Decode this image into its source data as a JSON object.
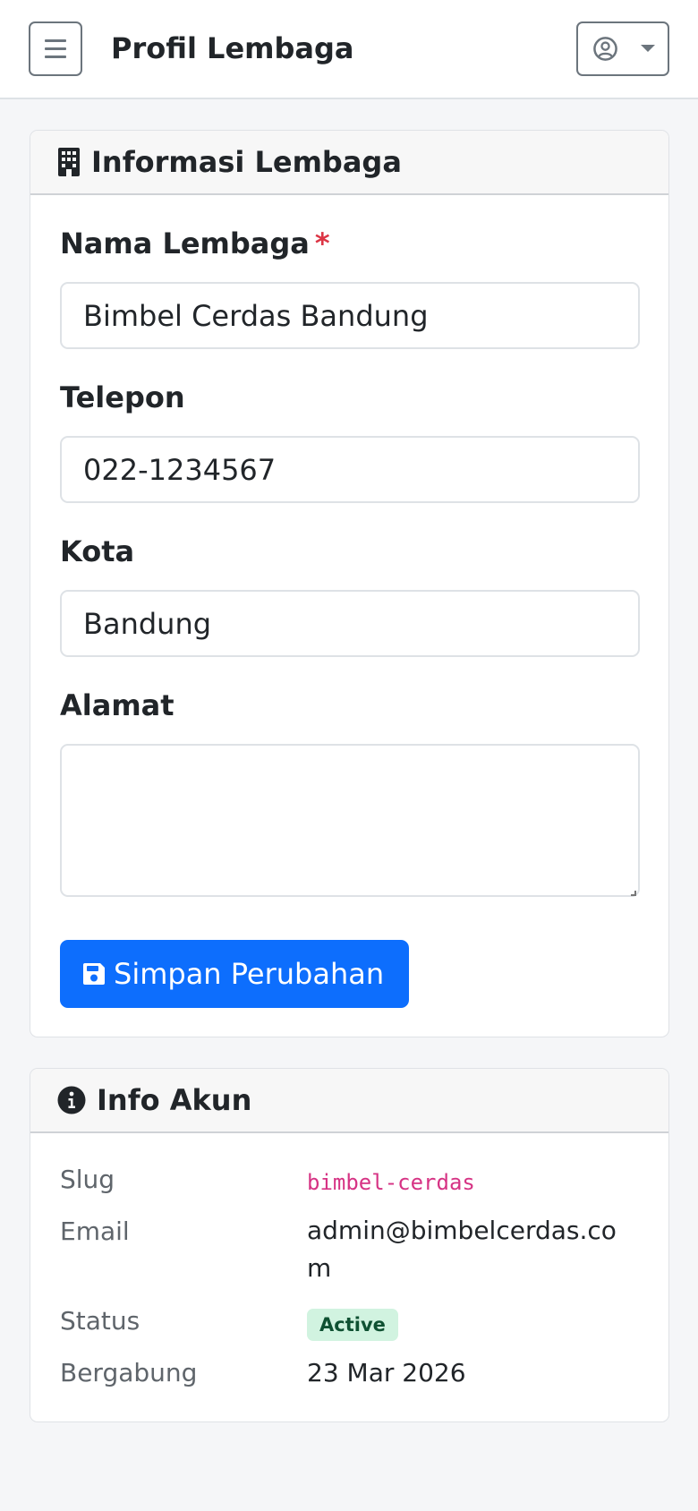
{
  "header": {
    "title": "Profil Lembaga"
  },
  "icons": {
    "menu": "hamburger-icon",
    "user": "user-circle-icon",
    "building": "building-icon",
    "info": "info-circle-icon",
    "save": "floppy-disk-icon"
  },
  "colors": {
    "primary": "#0d6efd",
    "required": "#dc3545",
    "slug": "#d63384",
    "badge_bg": "#d1f3e0",
    "badge_text": "#0f5132"
  },
  "institution_card": {
    "title": "Informasi Lembaga",
    "name_label": "Nama Lembaga",
    "required_mark": "*",
    "name_value": "Bimbel Cerdas Bandung",
    "phone_label": "Telepon",
    "phone_value": "022-1234567",
    "city_label": "Kota",
    "city_value": "Bandung",
    "address_label": "Alamat",
    "address_value": "",
    "save_label": "Simpan Perubahan"
  },
  "account_card": {
    "title": "Info Akun",
    "slug_label": "Slug",
    "slug_value": "bimbel-cerdas",
    "email_label": "Email",
    "email_value": "admin@bimbelcerdas.com",
    "status_label": "Status",
    "status_value": "Active",
    "joined_label": "Bergabung",
    "joined_value": "23 Mar 2026"
  }
}
